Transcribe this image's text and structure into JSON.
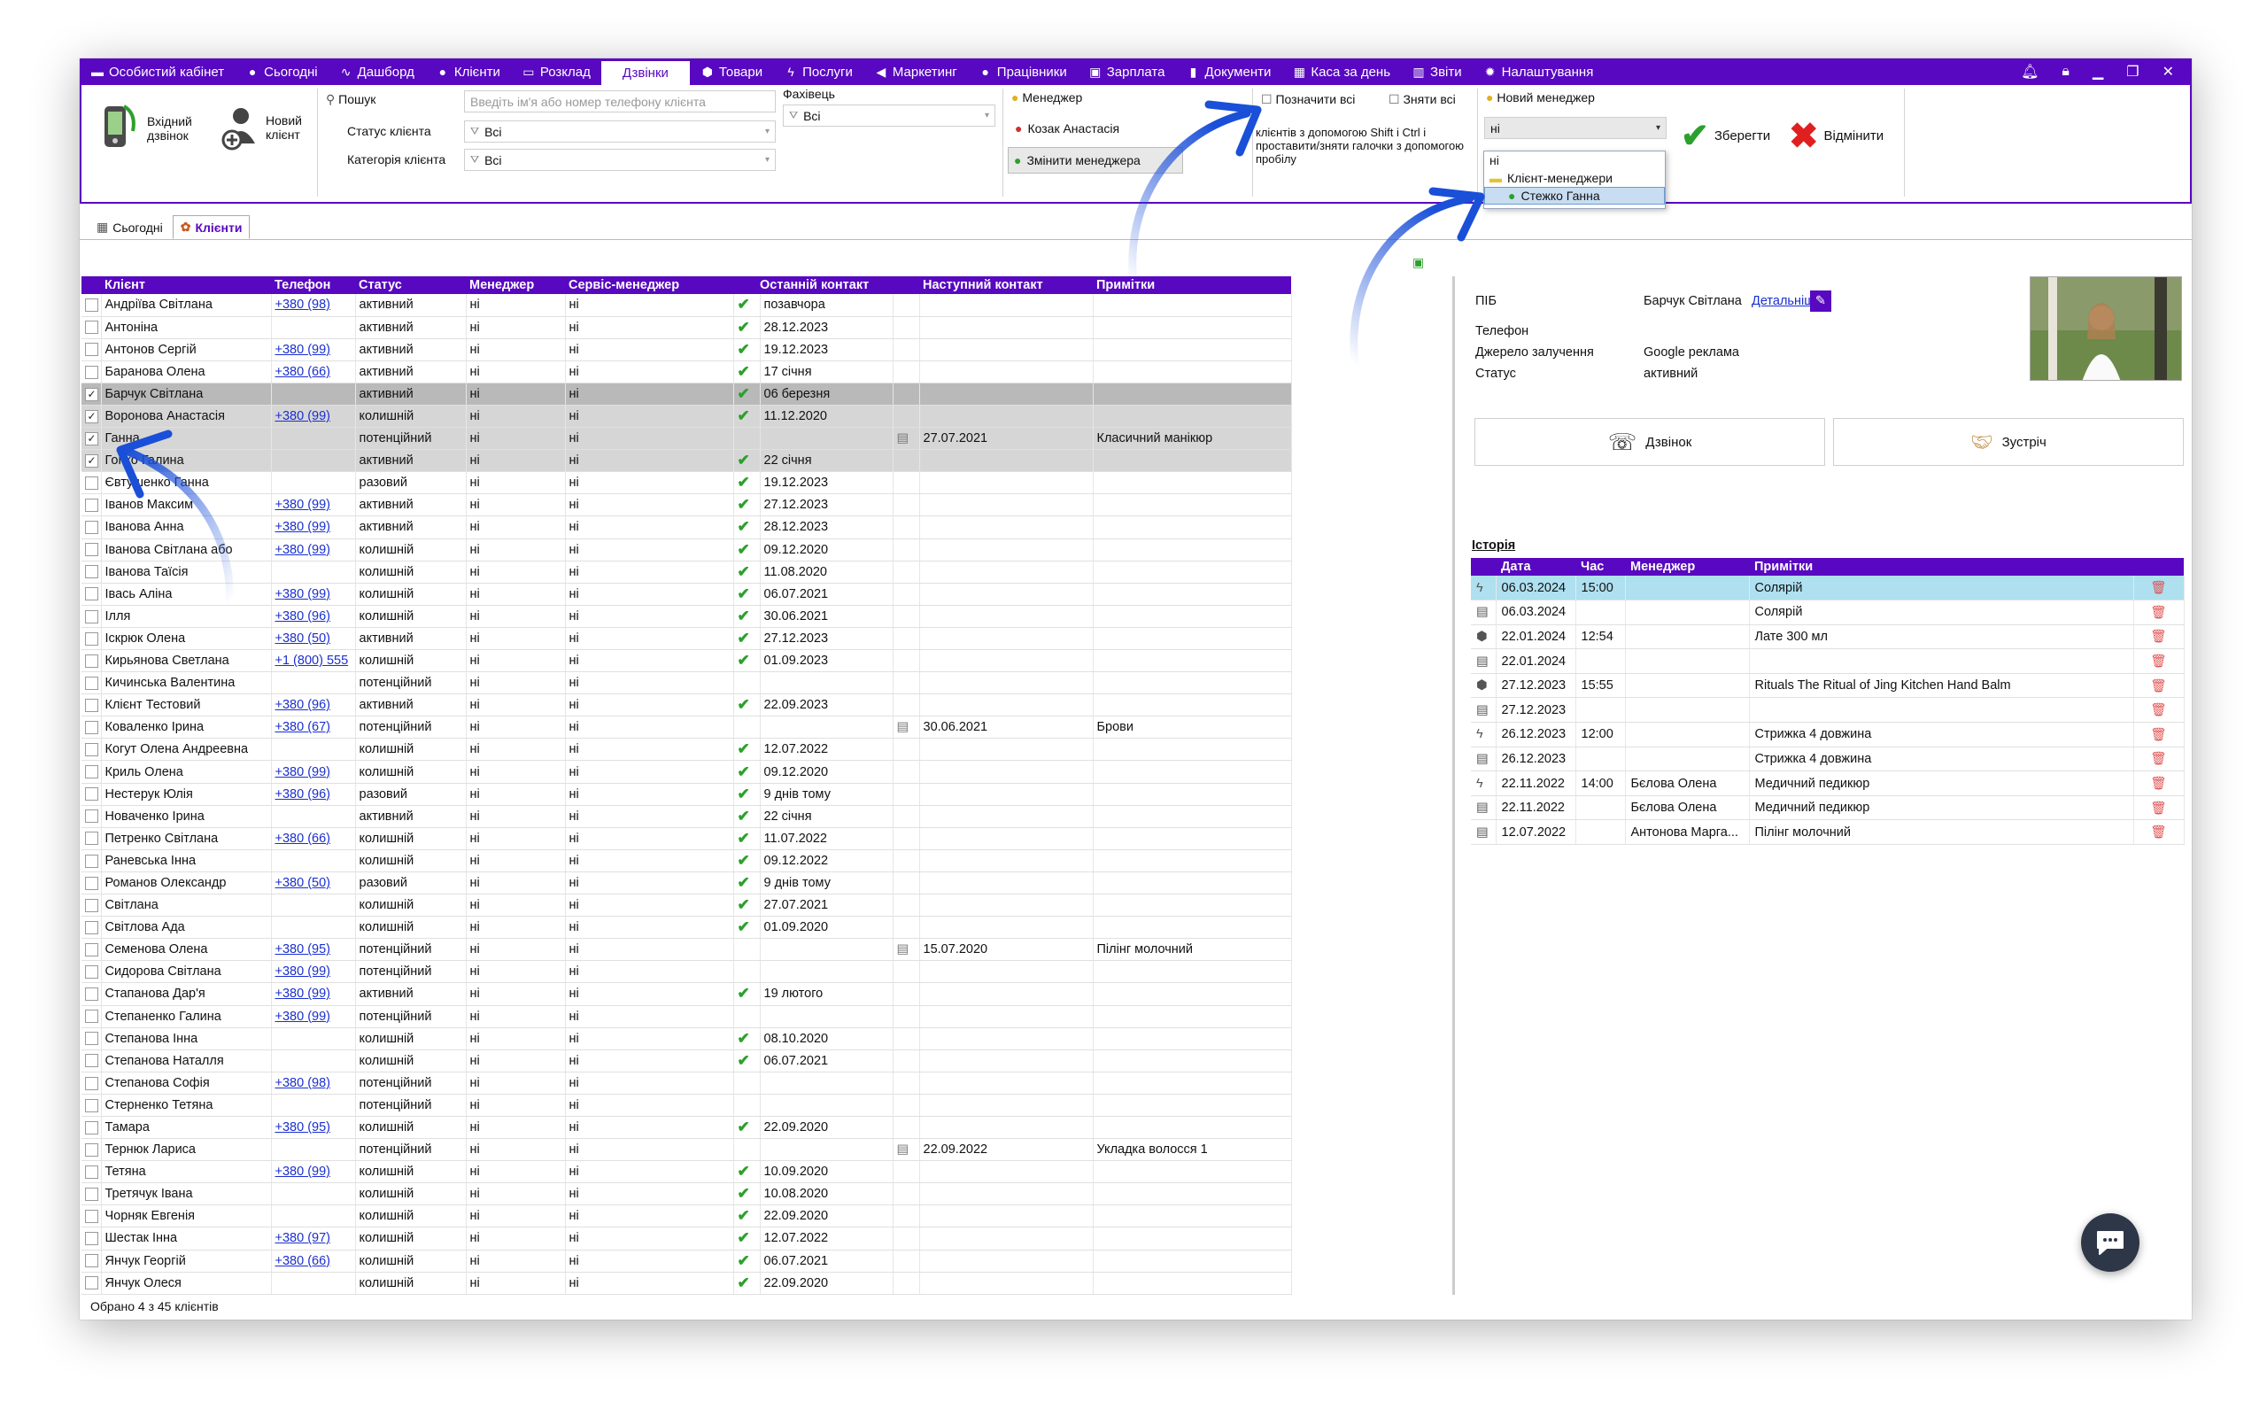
{
  "menu": {
    "items": [
      {
        "icon": "user-card-icon",
        "glyph": "▬",
        "label": "Особистий кабінет"
      },
      {
        "icon": "clock-icon",
        "glyph": "●",
        "label": "Сьогодні"
      },
      {
        "icon": "pulse-icon",
        "glyph": "∿",
        "label": "Дашборд"
      },
      {
        "icon": "person-icon",
        "glyph": "●",
        "label": "Клієнти"
      },
      {
        "icon": "calendar-icon",
        "glyph": "▭",
        "label": "Розклад"
      },
      {
        "icon": "",
        "glyph": "",
        "label": "Дзвінки",
        "active": true
      },
      {
        "icon": "box-icon",
        "glyph": "⬢",
        "label": "Товари"
      },
      {
        "icon": "lightning-icon",
        "glyph": "ϟ",
        "label": "Послуги"
      },
      {
        "icon": "megaphone-icon",
        "glyph": "◀",
        "label": "Маркетинг"
      },
      {
        "icon": "person-icon",
        "glyph": "●",
        "label": "Працівники"
      },
      {
        "icon": "money-icon",
        "glyph": "▣",
        "label": "Зарплата"
      },
      {
        "icon": "document-icon",
        "glyph": "▮",
        "label": "Документи"
      },
      {
        "icon": "cash-register-icon",
        "glyph": "▦",
        "label": "Каса за день"
      },
      {
        "icon": "bar-chart-icon",
        "glyph": "▥",
        "label": "Звіти"
      },
      {
        "icon": "gear-icon",
        "glyph": "✹",
        "label": "Налаштування"
      }
    ]
  },
  "toolbar": {
    "incoming_call": "Вхідний дзвінок",
    "new_client": "Новий клієнт",
    "search_label": "Пошук",
    "search_placeholder": "Введіть ім'я або номер телефону клієнта",
    "status_label": "Статус клієнта",
    "status_value": "Всі",
    "category_label": "Категорія клієнта",
    "category_value": "Всі",
    "specialist_label": "Фахівець",
    "specialist_value": "Всі",
    "manager_label": "Менеджер",
    "manager_value": "Козак Анастасія",
    "change_manager": "Змінити менеджера",
    "mark_all": "Позначити всі",
    "unmark_all": "Зняти всі",
    "hint": "клієнтів з допомогою Shift і Ctrl і проставити/зняти галочки з допомогою пробілу",
    "new_manager_label": "Новий менеджер",
    "new_manager_value": "ні",
    "save": "Зберегти",
    "cancel": "Відмінити"
  },
  "dropdown": {
    "items": [
      "ні",
      "Клієнт-менеджери",
      "Стежко Ганна"
    ]
  },
  "tabs": [
    {
      "label": "Сьогодні"
    },
    {
      "label": "Клієнти"
    }
  ],
  "grid": {
    "columns": [
      "Клієнт",
      "Телефон",
      "Статус",
      "Менеджер",
      "Сервіс-менеджер",
      "Останній контакт",
      "Наступний контакт",
      "Примітки"
    ],
    "rows": [
      [
        "Андріїва Світлана",
        "+380 (98)",
        "активний",
        "ні",
        "ні",
        "позавчора",
        "",
        "",
        0
      ],
      [
        "Антоніна",
        "",
        "активний",
        "ні",
        "ні",
        "28.12.2023",
        "",
        "",
        0
      ],
      [
        "Антонов Сергій",
        "+380 (99)",
        "активний",
        "ні",
        "ні",
        "19.12.2023",
        "",
        "",
        0
      ],
      [
        "Баранова Олена",
        "+380 (66)",
        "активний",
        "ні",
        "ні",
        "17 січня",
        "",
        "",
        0
      ],
      [
        "Барчук Світлана",
        "",
        "активний",
        "ні",
        "ні",
        "06 березня",
        "",
        "",
        2
      ],
      [
        "Воронова Анастасія",
        "+380 (99)",
        "колишній",
        "ні",
        "ні",
        "11.12.2020",
        "",
        "",
        1
      ],
      [
        "Ганна",
        "",
        "потенційний",
        "ні",
        "ні",
        "",
        "27.07.2021",
        "Класичний манікюр",
        1
      ],
      [
        "Гопко Галина",
        "",
        "активний",
        "ні",
        "ні",
        "22 січня",
        "",
        "",
        1
      ],
      [
        "Євтушенко Ганна",
        "",
        "разовий",
        "ні",
        "ні",
        "19.12.2023",
        "",
        "",
        0
      ],
      [
        "Іванов Максим",
        "+380 (99)",
        "активний",
        "ні",
        "ні",
        "27.12.2023",
        "",
        "",
        0
      ],
      [
        "Іванова Анна",
        "+380 (99)",
        "активний",
        "ні",
        "ні",
        "28.12.2023",
        "",
        "",
        0
      ],
      [
        "Іванова Світлана або",
        "+380 (99)",
        "колишній",
        "ні",
        "ні",
        "09.12.2020",
        "",
        "",
        0
      ],
      [
        "Іванова Таїсія",
        "",
        "колишній",
        "ні",
        "ні",
        "11.08.2020",
        "",
        "",
        0
      ],
      [
        "Івась Аліна",
        "+380 (99)",
        "колишній",
        "ні",
        "ні",
        "06.07.2021",
        "",
        "",
        0
      ],
      [
        "Ілля",
        "+380 (96)",
        "колишній",
        "ні",
        "ні",
        "30.06.2021",
        "",
        "",
        0
      ],
      [
        "Іскрюк Олена",
        "+380 (50)",
        "активний",
        "ні",
        "ні",
        "27.12.2023",
        "",
        "",
        0
      ],
      [
        "Кирьянова Светлана",
        "+1 (800) 555",
        "колишній",
        "ні",
        "ні",
        "01.09.2023",
        "",
        "",
        0
      ],
      [
        "Кичинська Валентина",
        "",
        "потенційний",
        "ні",
        "ні",
        "",
        "",
        "",
        0
      ],
      [
        "Клієнт Тестовий",
        "+380 (96)",
        "активний",
        "ні",
        "ні",
        "22.09.2023",
        "",
        "",
        0
      ],
      [
        "Коваленко Ірина",
        "+380 (67)",
        "потенційний",
        "ні",
        "ні",
        "",
        "30.06.2021",
        "Брови",
        0
      ],
      [
        "Когут Олена Андреевна",
        "",
        "колишній",
        "ні",
        "ні",
        "12.07.2022",
        "",
        "",
        0
      ],
      [
        "Криль Олена",
        "+380 (99)",
        "колишній",
        "ні",
        "ні",
        "09.12.2020",
        "",
        "",
        0
      ],
      [
        "Нестерук Юлія",
        "+380 (96)",
        "разовий",
        "ні",
        "ні",
        "9 днів тому",
        "",
        "",
        0
      ],
      [
        "Новаченко Ірина",
        "",
        "активний",
        "ні",
        "ні",
        "22 січня",
        "",
        "",
        0
      ],
      [
        "Петренко Світлана",
        "+380 (66)",
        "колишній",
        "ні",
        "ні",
        "11.07.2022",
        "",
        "",
        0
      ],
      [
        "Раневська Інна",
        "",
        "колишній",
        "ні",
        "ні",
        "09.12.2022",
        "",
        "",
        0
      ],
      [
        "Романов Олександр",
        "+380 (50)",
        "разовий",
        "ні",
        "ні",
        "9 днів тому",
        "",
        "",
        0
      ],
      [
        "Світлана",
        "",
        "колишній",
        "ні",
        "ні",
        "27.07.2021",
        "",
        "",
        0
      ],
      [
        "Світлова Ада",
        "",
        "колишній",
        "ні",
        "ні",
        "01.09.2020",
        "",
        "",
        0
      ],
      [
        "Семенова Олена",
        "+380 (95)",
        "потенційний",
        "ні",
        "ні",
        "",
        "15.07.2020",
        "Пілінг молочний",
        0
      ],
      [
        "Сидорова Світлана",
        "+380 (99)",
        "потенційний",
        "ні",
        "ні",
        "",
        "",
        "",
        0
      ],
      [
        "Стапанова Дар'я",
        "+380 (99)",
        "активний",
        "ні",
        "ні",
        "19 лютого",
        "",
        "",
        0
      ],
      [
        "Степаненко Галина",
        "+380 (99)",
        "потенційний",
        "ні",
        "ні",
        "",
        "",
        "",
        0
      ],
      [
        "Степанова Інна",
        "",
        "колишній",
        "ні",
        "ні",
        "08.10.2020",
        "",
        "",
        0
      ],
      [
        "Степанова Наталля",
        "",
        "колишній",
        "ні",
        "ні",
        "06.07.2021",
        "",
        "",
        0
      ],
      [
        "Степанова Софія",
        "+380 (98)",
        "потенційний",
        "ні",
        "ні",
        "",
        "",
        "",
        0
      ],
      [
        "Стерненко Тетяна",
        "",
        "потенційний",
        "ні",
        "ні",
        "",
        "",
        "",
        0
      ],
      [
        "Тамара",
        "+380 (95)",
        "колишній",
        "ні",
        "ні",
        "22.09.2020",
        "",
        "",
        0
      ],
      [
        "Тернюк Лариса",
        "",
        "потенційний",
        "ні",
        "ні",
        "",
        "22.09.2022",
        "Укладка волосся 1",
        0
      ],
      [
        "Тетяна",
        "+380 (99)",
        "колишній",
        "ні",
        "ні",
        "10.09.2020",
        "",
        "",
        0
      ],
      [
        "Третячук Івана",
        "",
        "колишній",
        "ні",
        "ні",
        "10.08.2020",
        "",
        "",
        0
      ],
      [
        "Чорняк Евгенія",
        "",
        "колишній",
        "ні",
        "ні",
        "22.09.2020",
        "",
        "",
        0
      ],
      [
        "Шестак Інна",
        "+380 (97)",
        "колишній",
        "ні",
        "ні",
        "12.07.2022",
        "",
        "",
        0
      ],
      [
        "Янчук Георгій",
        "+380 (66)",
        "колишній",
        "ні",
        "ні",
        "06.07.2021",
        "",
        "",
        0
      ],
      [
        "Янчук Олеся",
        "",
        "колишній",
        "ні",
        "ні",
        "22.09.2020",
        "",
        "",
        0
      ]
    ]
  },
  "footer": "Обрано 4 з 45 клієнтів",
  "details": {
    "pib_label": "ПІБ",
    "pib_value": "Барчук Світлана",
    "details_link": "Детальніше",
    "phone_label": "Телефон",
    "source_label": "Джерело залучення",
    "source_value": "Google реклама",
    "status_label": "Статус",
    "status_value": "активний",
    "call_btn": "Дзвінок",
    "meet_btn": "Зустріч",
    "history_title": "Історія"
  },
  "history": {
    "columns": [
      "Дата",
      "Час",
      "Менеджер",
      "Примітки"
    ],
    "rows": [
      [
        "ϟ",
        "06.03.2024",
        "15:00",
        "",
        "Солярій",
        1
      ],
      [
        "▤",
        "06.03.2024",
        "",
        "",
        "Солярій",
        0
      ],
      [
        "⬢",
        "22.01.2024",
        "12:54",
        "",
        "Лате 300 мл",
        0
      ],
      [
        "▤",
        "22.01.2024",
        "",
        "",
        "",
        0
      ],
      [
        "⬢",
        "27.12.2023",
        "15:55",
        "",
        "Rituals The Ritual of Jing Kitchen Hand Balm",
        0
      ],
      [
        "▤",
        "27.12.2023",
        "",
        "",
        "",
        0
      ],
      [
        "ϟ",
        "26.12.2023",
        "12:00",
        "",
        "Стрижка 4 довжина",
        0
      ],
      [
        "▤",
        "26.12.2023",
        "",
        "",
        "Стрижка 4 довжина",
        0
      ],
      [
        "ϟ",
        "22.11.2022",
        "14:00",
        "Бєлова Олена",
        "Медичний педикюр",
        0
      ],
      [
        "▤",
        "22.11.2022",
        "",
        "Бєлова Олена",
        "Медичний педикюр",
        0
      ],
      [
        "▤",
        "12.07.2022",
        "",
        "Антонова Марга...",
        "Пілінг молочний",
        0
      ]
    ]
  },
  "colors": {
    "accent": "#5808c0",
    "check": "#2ca02c",
    "arrow": "#1a4fd8",
    "highlight": "#aee0f0"
  }
}
